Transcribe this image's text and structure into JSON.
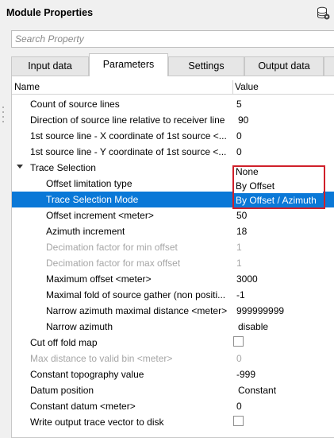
{
  "window": {
    "title": "Module Properties",
    "icon": "database-settings-icon"
  },
  "search": {
    "placeholder": "Search Property"
  },
  "tabs": [
    {
      "label": "Input data",
      "active": false
    },
    {
      "label": "Parameters",
      "active": true
    },
    {
      "label": "Settings",
      "active": false
    },
    {
      "label": "Output data",
      "active": false
    }
  ],
  "grid": {
    "header": {
      "name": "Name",
      "value": "Value"
    },
    "rows": [
      {
        "name": "Count of source lines",
        "value": "5"
      },
      {
        "name": "Direction of source line relative to receiver line",
        "value": "90"
      },
      {
        "name": "1st source line - X coordinate of 1st source <...",
        "value": "0"
      },
      {
        "name": "1st source line - Y coordinate of 1st source <...",
        "value": "0"
      },
      {
        "name": "Trace Selection",
        "value": ""
      },
      {
        "name": "Offset limitation type",
        "value": ""
      },
      {
        "name": "Trace Selection Mode",
        "value": ""
      },
      {
        "name": "Offset increment <meter>",
        "value": "50"
      },
      {
        "name": "Azimuth increment",
        "value": "18"
      },
      {
        "name": "Decimation factor for min offset",
        "value": "1"
      },
      {
        "name": "Decimation factor for max offset",
        "value": "1"
      },
      {
        "name": "Maximum offset <meter>",
        "value": "3000"
      },
      {
        "name": "Maximal fold of source gather (non positi...",
        "value": "-1"
      },
      {
        "name": "Narrow azimuth maximal distance <meter>",
        "value": "999999999"
      },
      {
        "name": "Narrow azimuth",
        "value": "disable"
      },
      {
        "name": "Cut off fold map",
        "value": ""
      },
      {
        "name": "Max distance to valid bin <meter>",
        "value": "0"
      },
      {
        "name": "Constant topography value",
        "value": "-999"
      },
      {
        "name": "Datum position",
        "value": "Constant"
      },
      {
        "name": "Constant datum <meter>",
        "value": "0"
      },
      {
        "name": "Write output trace vector to disk",
        "value": ""
      }
    ]
  },
  "dropdown": {
    "options": [
      "None",
      "By Offset",
      "By Offset / Azimuth"
    ],
    "selected": "By Offset / Azimuth",
    "highlight_color": "#d0202a"
  },
  "colors": {
    "selection": "#0a78d7",
    "disabled_text": "#a6a6a6"
  }
}
